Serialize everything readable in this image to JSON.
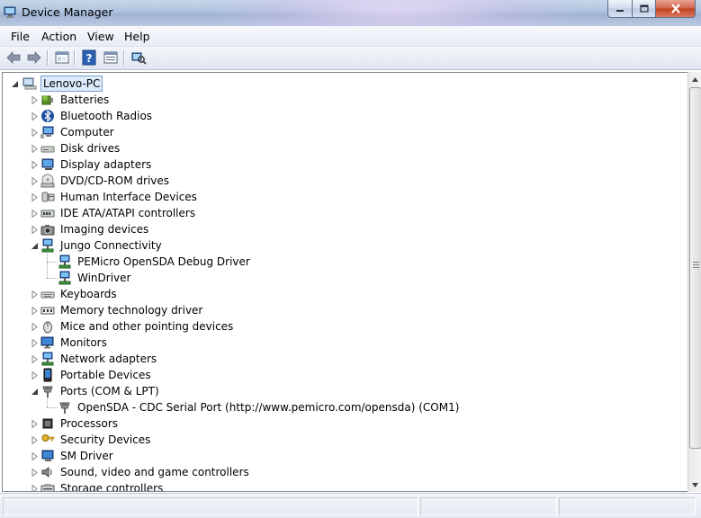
{
  "window": {
    "title": "Device Manager"
  },
  "menu": [
    "File",
    "Action",
    "View",
    "Help"
  ],
  "toolbar": {
    "buttons": [
      "back-arrow",
      "forward-arrow",
      "properties",
      "help",
      "show-hide-console-tree",
      "scan-hardware-changes"
    ]
  },
  "tree": {
    "root": "Lenovo-PC",
    "items": [
      {
        "label": "Batteries",
        "icon": "battery-icon",
        "expanded": false
      },
      {
        "label": "Bluetooth Radios",
        "icon": "bluetooth-icon",
        "expanded": false
      },
      {
        "label": "Computer",
        "icon": "computer-icon",
        "expanded": false
      },
      {
        "label": "Disk drives",
        "icon": "disk-drive-icon",
        "expanded": false
      },
      {
        "label": "Display adapters",
        "icon": "display-adapter-icon",
        "expanded": false
      },
      {
        "label": "DVD/CD-ROM drives",
        "icon": "dvd-drive-icon",
        "expanded": false
      },
      {
        "label": "Human Interface Devices",
        "icon": "hid-icon",
        "expanded": false
      },
      {
        "label": "IDE ATA/ATAPI controllers",
        "icon": "ide-controller-icon",
        "expanded": false
      },
      {
        "label": "Imaging devices",
        "icon": "camera-icon",
        "expanded": false
      },
      {
        "label": "Jungo Connectivity",
        "icon": "network-device-icon",
        "expanded": true,
        "children": [
          "PEMicro OpenSDA Debug Driver",
          "WinDriver"
        ]
      },
      {
        "label": "Keyboards",
        "icon": "keyboard-icon",
        "expanded": false
      },
      {
        "label": "Memory technology driver",
        "icon": "memory-icon",
        "expanded": false
      },
      {
        "label": "Mice and other pointing devices",
        "icon": "mouse-icon",
        "expanded": false
      },
      {
        "label": "Monitors",
        "icon": "monitor-icon",
        "expanded": false
      },
      {
        "label": "Network adapters",
        "icon": "network-adapter-icon",
        "expanded": false
      },
      {
        "label": "Portable Devices",
        "icon": "portable-device-icon",
        "expanded": false
      },
      {
        "label": "Ports (COM & LPT)",
        "icon": "port-icon",
        "expanded": true,
        "children": [
          "OpenSDA - CDC Serial Port (http://www.pemicro.com/opensda) (COM1)"
        ]
      },
      {
        "label": "Processors",
        "icon": "processor-icon",
        "expanded": false
      },
      {
        "label": "Security Devices",
        "icon": "key-icon",
        "expanded": false
      },
      {
        "label": "SM Driver",
        "icon": "sm-driver-icon",
        "expanded": false
      },
      {
        "label": "Sound, video and game controllers",
        "icon": "speaker-icon",
        "expanded": false
      },
      {
        "label": "Storage controllers",
        "icon": "storage-controller-icon",
        "expanded": false
      }
    ]
  },
  "colors": {
    "titlebar": "#aec3dd",
    "selection": "#dcebfc",
    "selection_border": "#7da2ce"
  }
}
